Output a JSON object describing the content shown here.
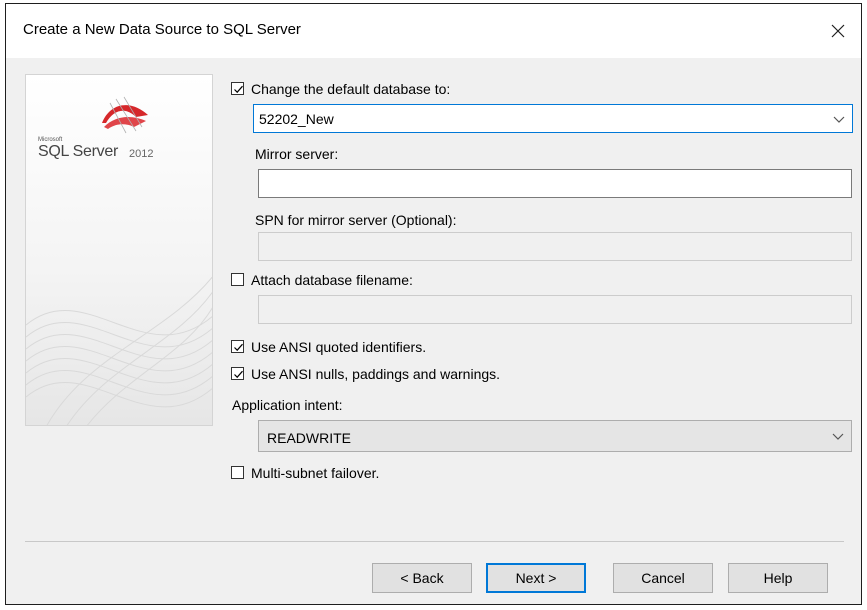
{
  "window": {
    "title": "Create a New Data Source to SQL Server",
    "close_icon": "close-icon"
  },
  "banner": {
    "brand_small": "Microsoft",
    "product": "SQL Server",
    "version": "2012"
  },
  "options": {
    "change_default_db": {
      "label": "Change the default database to:",
      "checked": true
    },
    "database_combo": {
      "value": "52202_New"
    },
    "mirror_server": {
      "label": "Mirror server:",
      "value": ""
    },
    "spn_mirror": {
      "label": "SPN for mirror server (Optional):",
      "value": ""
    },
    "attach_db": {
      "label": "Attach database filename:",
      "checked": false,
      "value": ""
    },
    "ansi_quoted": {
      "label": "Use ANSI quoted identifiers.",
      "checked": true
    },
    "ansi_nulls": {
      "label": "Use ANSI nulls, paddings and warnings.",
      "checked": true
    },
    "app_intent": {
      "label": "Application intent:",
      "value": "READWRITE"
    },
    "multisubnet": {
      "label": "Multi-subnet failover.",
      "checked": false
    }
  },
  "buttons": {
    "back": "< Back",
    "next": "Next >",
    "cancel": "Cancel",
    "help": "Help"
  },
  "colors": {
    "focus_accent": "#0078d7",
    "logo_red": "#d6282b"
  }
}
